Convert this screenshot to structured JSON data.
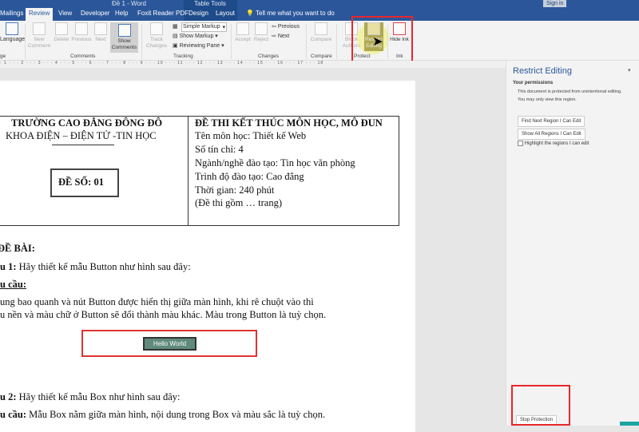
{
  "titlebar": {
    "doc_title": "Đề 1 - Word",
    "table_tools": "Table Tools",
    "sign_in": "Sign in"
  },
  "tabs": [
    "Mailings",
    "Review",
    "View",
    "Developer",
    "Help",
    "Foxit Reader PDF",
    "Design",
    "Layout"
  ],
  "tell_me": "Tell me what you want to do",
  "ribbon": {
    "language": "Language",
    "language_group": "ge",
    "comments": {
      "new": "New Comment",
      "delete": "Delete",
      "previous": "Previous",
      "next": "Next",
      "show": "Show Comments",
      "group": "Comments"
    },
    "tracking": {
      "track": "Track Changes",
      "markup_select": "Simple Markup",
      "show_markup": "Show Markup",
      "reviewing_pane": "Reviewing Pane",
      "group": "Tracking"
    },
    "changes": {
      "accept": "Accept",
      "reject": "Reject",
      "previous": "Previous",
      "next": "Next",
      "group": "Changes"
    },
    "compare": {
      "compare": "Compare",
      "group": "Compare"
    },
    "protect": {
      "block": "Block Authors",
      "restrict": "Restrict Editing",
      "group": "Protect"
    },
    "ink": {
      "hide": "Hide Ink",
      "group": "Ink"
    }
  },
  "ruler": "· 1 · · · 2 · · · 3 · · · 4 · · · 5 · · · 6 · · · 7 · · · 8 · · · 9 · · · 10 · · · 11 · · · 12 · · · 13 · · · 14 · · · 15 · · · 16 · · · 17 · · · 18",
  "pane": {
    "title": "Restrict Editing",
    "permissions": "Your permissions",
    "msg1": "This document is protected from unintentional editing.",
    "msg2": "You may only view this region.",
    "find_next": "Find Next Region I Can Edit",
    "show_all": "Show All Regions I Can Edit",
    "highlight": "Highlight the regions I can edit",
    "stop": "Stop Protection"
  },
  "document": {
    "school": "TRƯỜNG CAO ĐẲNG ĐÔNG ĐÔ",
    "faculty": "KHOA ĐIỆN – ĐIỆN TỬ -TIN HỌC",
    "exam_no": "ĐỀ SỐ: 01",
    "exam_title": "ĐỀ THI KẾT THÚC MÔN HỌC, MÔ ĐUN",
    "info": [
      "Tên môn học:  Thiết kế Web",
      "Số tín chỉ: 4",
      "Ngành/nghề đào tạo: Tin học văn phòng",
      "Trình độ đào tạo: Cao đẳng",
      "Thời gian: 240 phút",
      "(Đề thi gồm … trang)"
    ],
    "heading": "ĐỀ BÀI:",
    "q1_label": "u 1:",
    "q1": " Hãy thiết kế mẫu Button như hình sau đây:",
    "req_label": "u cầu:",
    "req_text1": "ung bao quanh và nút Button được hiển thị giữa màn hình, khi rê chuột vào thì",
    "req_text2": "u nền và màu chữ ở Button sẽ đổi thành màu khác. Màu trong Button là tuỳ chọn.",
    "hello_button": "Hello World",
    "q2_label": "u 2:",
    "q2": " Hãy thiết kế mẫu Box như hình sau đây:",
    "q2req_label": "u cầu:",
    "q2req": " Mẫu Box nằm giữa màn hình, nội dung trong Box và màu sắc là tuỳ chọn."
  }
}
